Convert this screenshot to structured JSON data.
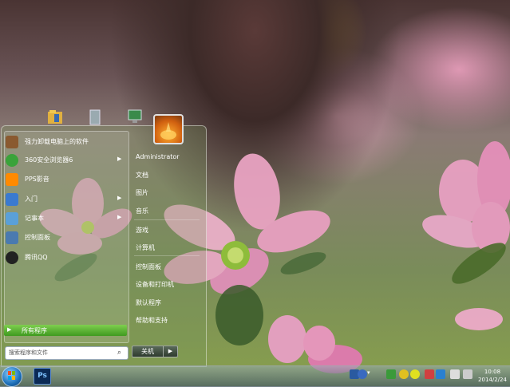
{
  "start_menu": {
    "programs": [
      {
        "label": "强力卸载电脑上的软件",
        "icon": "uninstall-icon",
        "color": "#8a5a30",
        "has_arrow": false
      },
      {
        "label": "360安全浏览器6",
        "icon": "360-browser-icon",
        "color": "#3aa33a",
        "has_arrow": true
      },
      {
        "label": "PPS影音",
        "icon": "pps-icon",
        "color": "#ff8a00",
        "has_arrow": false
      },
      {
        "label": "入门",
        "icon": "getting-started-icon",
        "color": "#3a7ad0",
        "has_arrow": true
      },
      {
        "label": "记事本",
        "icon": "notepad-icon",
        "color": "#5aa0d8",
        "has_arrow": true
      },
      {
        "label": "控制面板",
        "icon": "control-panel-icon",
        "color": "#4a7ab0",
        "has_arrow": false
      },
      {
        "label": "腾讯QQ",
        "icon": "qq-icon",
        "color": "#222222",
        "has_arrow": false
      }
    ],
    "all_programs": "所有程序",
    "search_placeholder": "搜索程序和文件",
    "right_items": [
      "Administrator",
      "文档",
      "图片",
      "音乐",
      "游戏",
      "计算机",
      "控制面板",
      "设备和打印机",
      "默认程序",
      "帮助和支持"
    ],
    "shutdown_label": "关机"
  },
  "taskbar": {
    "pinned": [
      {
        "label": "Ps",
        "icon": "photoshop-icon"
      }
    ],
    "clock_time": "10:08",
    "clock_date": "2014/2/24"
  }
}
